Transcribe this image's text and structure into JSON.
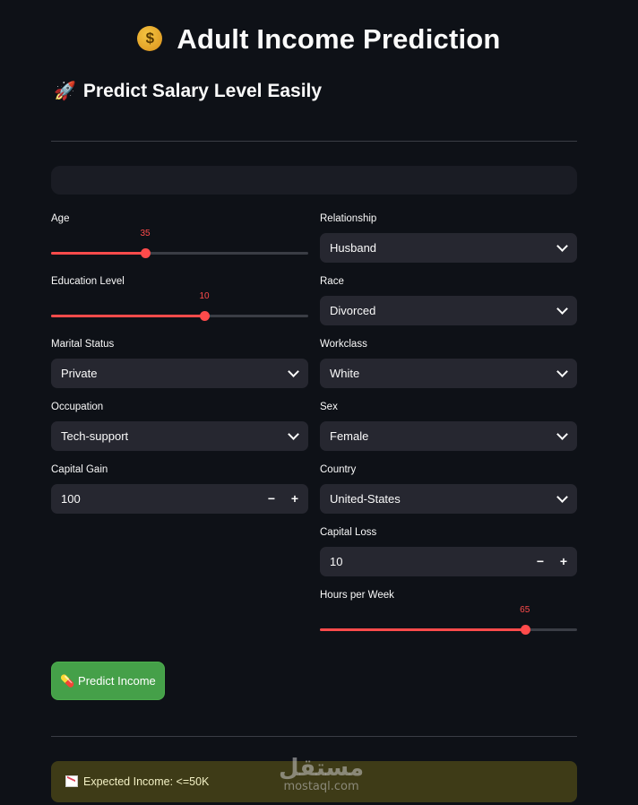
{
  "page": {
    "title": "Adult Income Prediction",
    "title_icon": "money-bag-icon",
    "subtitle": "Predict Salary Level Easily",
    "subtitle_icon": "rocket-icon"
  },
  "colors": {
    "accent": "#ff4b4b",
    "background": "#0e1117",
    "input_bg": "#262730",
    "button": "#45a049",
    "result_bg": "#3e3b17"
  },
  "left": {
    "age": {
      "label": "Age",
      "value": "35",
      "fraction": 0.366
    },
    "education": {
      "label": "Education Level",
      "value": "10",
      "fraction": 0.596
    },
    "marital": {
      "label": "Marital Status",
      "value": "Private"
    },
    "occupation": {
      "label": "Occupation",
      "value": "Tech-support"
    },
    "capital_gain": {
      "label": "Capital Gain",
      "value": "100",
      "minus": "−",
      "plus": "+"
    }
  },
  "right": {
    "relationship": {
      "label": "Relationship",
      "value": "Husband"
    },
    "race": {
      "label": "Race",
      "value": "Divorced"
    },
    "workclass": {
      "label": "Workclass",
      "value": "White"
    },
    "sex": {
      "label": "Sex",
      "value": "Female"
    },
    "country": {
      "label": "Country",
      "value": "United-States"
    },
    "capital_loss": {
      "label": "Capital Loss",
      "value": "10",
      "minus": "−",
      "plus": "+"
    },
    "hours": {
      "label": "Hours per Week",
      "value": "65",
      "fraction": 0.797
    }
  },
  "predict_button": {
    "label": "Predict Income",
    "icon": "pill-icon"
  },
  "result": {
    "text": "Expected Income: <=50K",
    "icon": "chart-decreasing-icon"
  },
  "watermark": {
    "arabic": "مستقل",
    "latin": "mostaql.com"
  }
}
